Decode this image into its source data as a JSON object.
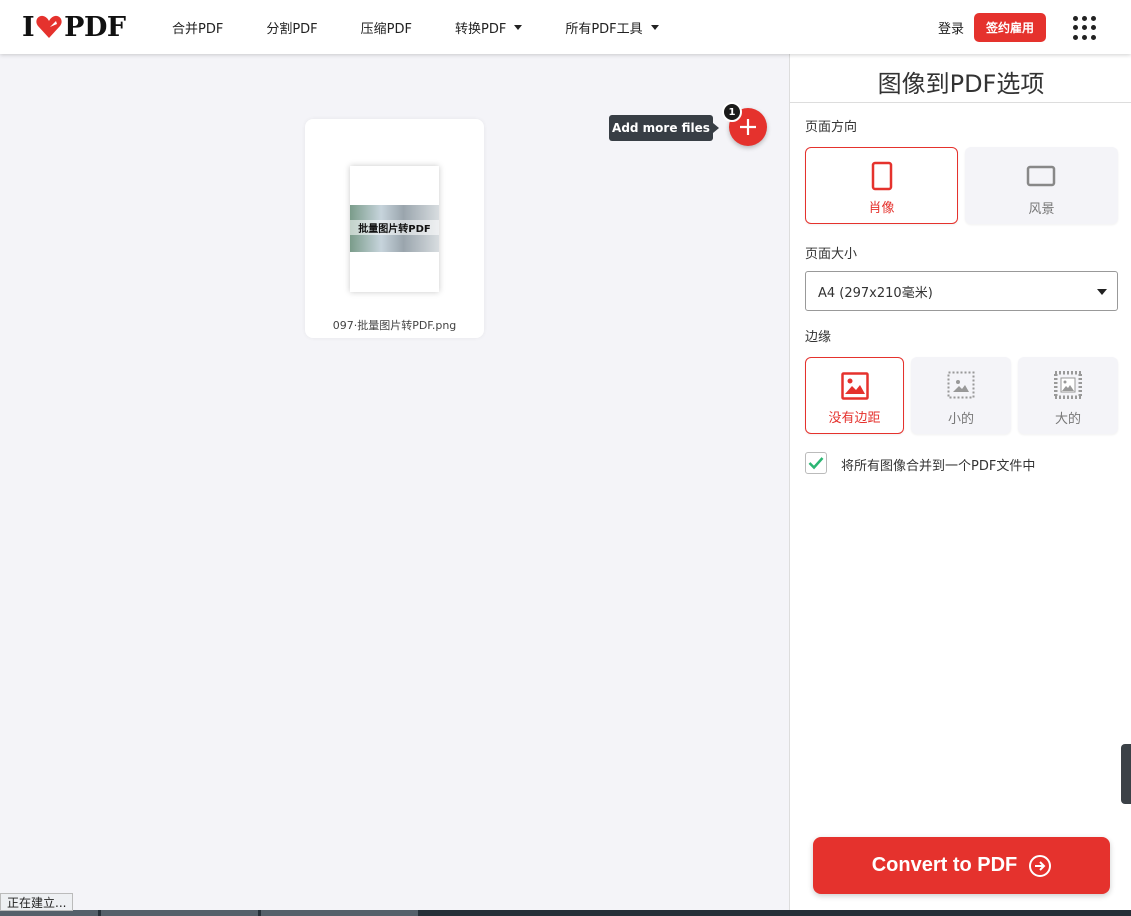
{
  "header": {
    "logo_left": "I",
    "logo_right": "PDF",
    "nav": [
      {
        "label": "合并PDF",
        "has_caret": false
      },
      {
        "label": "分割PDF",
        "has_caret": false
      },
      {
        "label": "压缩PDF",
        "has_caret": false
      },
      {
        "label": "转换PDF",
        "has_caret": true
      },
      {
        "label": "所有PDF工具",
        "has_caret": true
      }
    ],
    "login": "登录",
    "signup": "签约雇用",
    "apps_icon": "grid-icon"
  },
  "workarea": {
    "file": {
      "thumb_text": "批量图片转PDF",
      "name": "097·批量图片转PDF.png"
    },
    "tooltip": "Add more files",
    "file_count": "1"
  },
  "sidebar": {
    "title": "图像到PDF选项",
    "orientation": {
      "label": "页面方向",
      "options": [
        {
          "label": "肖像",
          "active": true
        },
        {
          "label": "风景",
          "active": false
        }
      ]
    },
    "page_size": {
      "label": "页面大小",
      "value": "A4 (297x210毫米)"
    },
    "margin": {
      "label": "边缘",
      "options": [
        {
          "label": "没有边距",
          "active": true
        },
        {
          "label": "小的",
          "active": false
        },
        {
          "label": "大的",
          "active": false
        }
      ]
    },
    "merge": {
      "checked": true,
      "label": "将所有图像合并到一个PDF文件中"
    },
    "convert_label": "Convert to PDF"
  },
  "status_bar": "正在建立...",
  "colors": {
    "brand": "#e5322d",
    "check": "#2bb673"
  }
}
